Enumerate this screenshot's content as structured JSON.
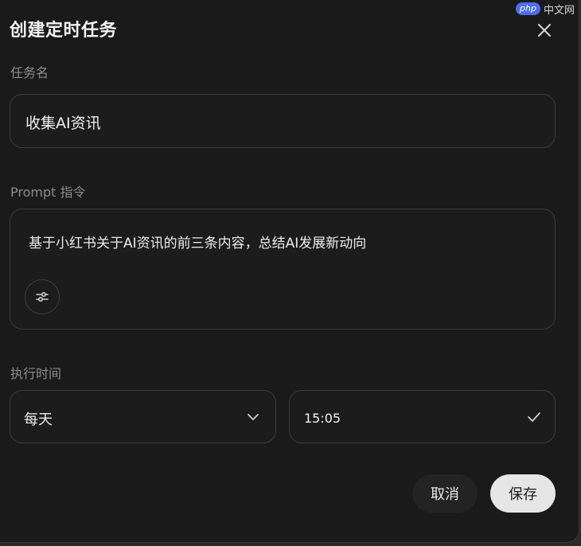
{
  "dialog": {
    "title": "创建定时任务",
    "close_icon": "close-icon"
  },
  "watermark": {
    "badge": "php",
    "text": "中文网"
  },
  "task_name": {
    "label": "任务名",
    "value": "收集AI资讯"
  },
  "prompt": {
    "label": "Prompt 指令",
    "value": "基于小红书关于AI资讯的前三条内容，总结AI发展新动向",
    "settings_icon": "sliders-icon"
  },
  "schedule": {
    "label": "执行时间",
    "frequency": "每天",
    "time": "15:05"
  },
  "buttons": {
    "cancel": "取消",
    "save": "保存"
  },
  "colors": {
    "background": "#1a1a1a",
    "field_border": "#3b3b3b",
    "save_button": "#e6e6e6"
  }
}
